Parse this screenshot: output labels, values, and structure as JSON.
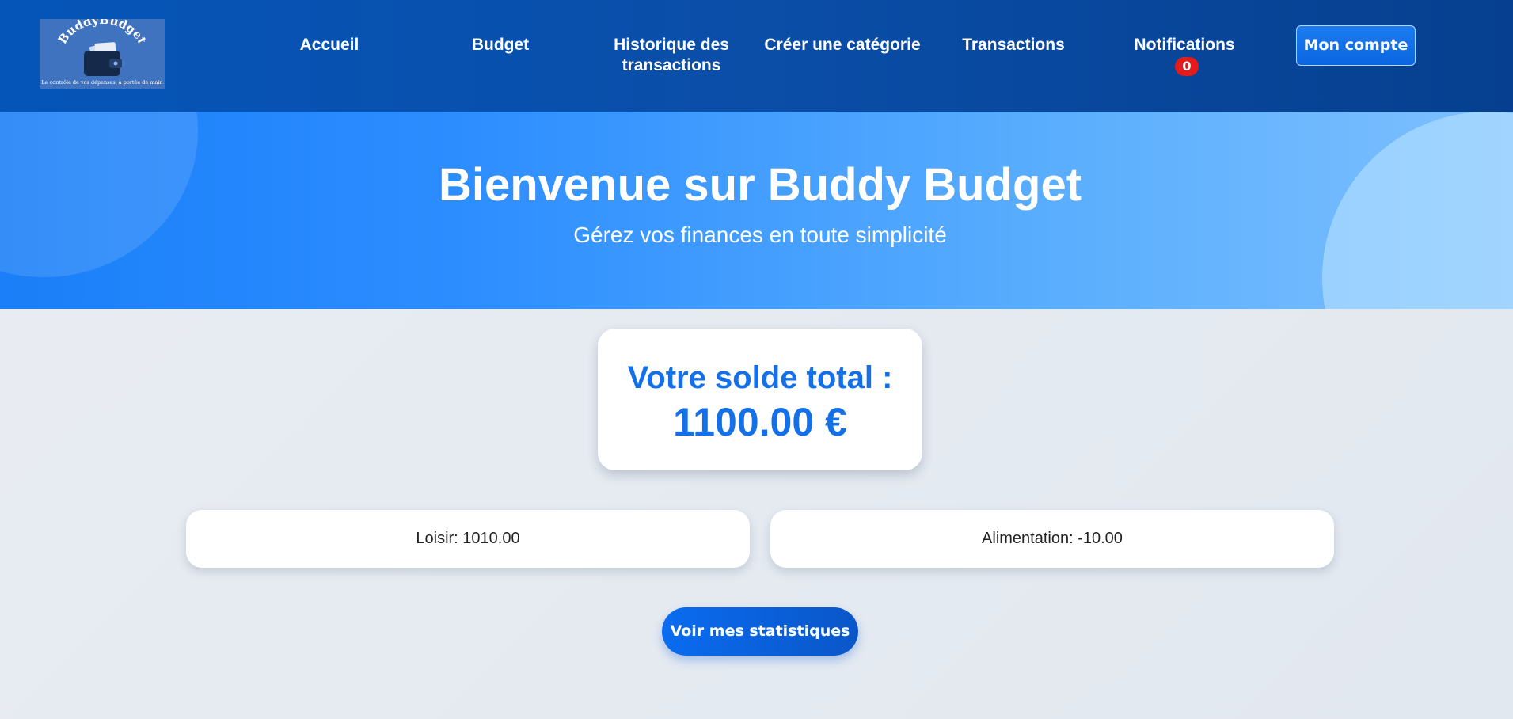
{
  "header": {
    "logo": {
      "title": "BuddyBudget",
      "tagline": "Le contrôle de vos dépenses, à portée de main",
      "icon": "wallet-icon"
    },
    "nav": [
      {
        "label": "Accueil"
      },
      {
        "label": "Budget"
      },
      {
        "label": "Historique des transactions"
      },
      {
        "label": "Créer une catégorie"
      },
      {
        "label": "Transactions"
      },
      {
        "label": "Notifications"
      }
    ],
    "notifications_count": "0",
    "account_label": "Mon compte"
  },
  "hero": {
    "title": "Bienvenue sur Buddy Budget",
    "subtitle": "Gérez vos finances en toute simplicité"
  },
  "balance": {
    "label": "Votre solde total :",
    "value": "1100.00 €"
  },
  "categories": [
    {
      "text": "Loisir: 1010.00"
    },
    {
      "text": "Alimentation: -10.00"
    }
  ],
  "stats_button_label": "Voir mes statistiques",
  "colors": {
    "header_bg": "#0a4ea8",
    "accent": "#1470e8",
    "badge": "#e21b1b"
  }
}
